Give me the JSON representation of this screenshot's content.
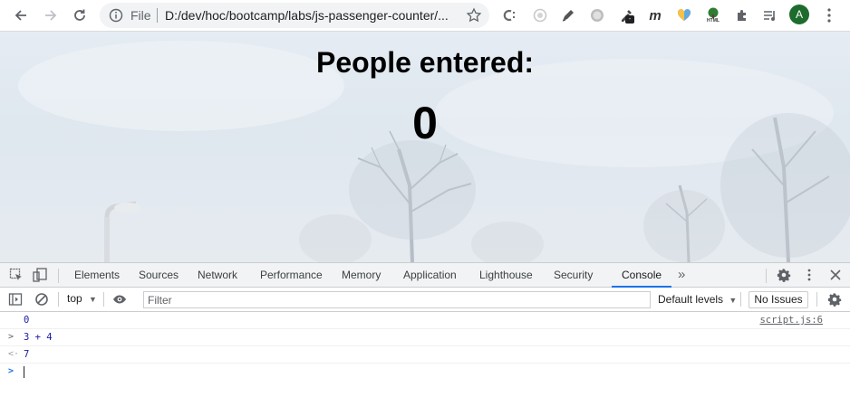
{
  "browser": {
    "omnibox": {
      "scheme_label": "File",
      "url": "D:/dev/hoc/bootcamp/labs/js-passenger-counter/..."
    },
    "extensions": [
      "c-icon",
      "circle-icon",
      "pen-icon",
      "coin-icon",
      "eyedropper-icon",
      "m-icon",
      "heart-icon",
      "tree-icon",
      "puzzle-icon",
      "media-icon"
    ],
    "extension_labels": {
      "m": "m",
      "html": "HTML"
    },
    "avatar_letter": "A"
  },
  "page": {
    "heading": "People entered:",
    "count": "0"
  },
  "devtools": {
    "tabs": [
      {
        "label": "Elements",
        "active": false
      },
      {
        "label": "Sources",
        "active": false
      },
      {
        "label": "Network",
        "active": false
      },
      {
        "label": "Performance",
        "active": false
      },
      {
        "label": "Memory",
        "active": false
      },
      {
        "label": "Application",
        "active": false
      },
      {
        "label": "Lighthouse",
        "active": false
      },
      {
        "label": "Security",
        "active": false
      },
      {
        "label": "Console",
        "active": true
      }
    ],
    "more_tabs": "»",
    "console_toolbar": {
      "context": "top",
      "filter_placeholder": "Filter",
      "levels": "Default levels",
      "issues": "No Issues"
    },
    "console": {
      "log_value": "0",
      "log_source": "script.js:6",
      "input_expr": "3 + 4",
      "result": "7"
    }
  },
  "colors": {
    "accent": "#1a73e8",
    "console_number": "#1a1aa6",
    "prompt": "#1a73e8"
  }
}
